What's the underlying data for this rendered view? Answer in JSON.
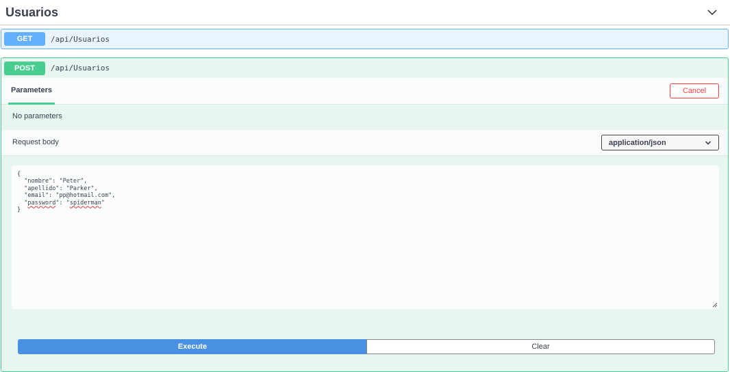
{
  "section": {
    "title": "Usuarios",
    "toggle_icon": "chevron-down-icon"
  },
  "get_op": {
    "method": "GET",
    "path": "/api/Usuarios"
  },
  "post_op": {
    "method": "POST",
    "path": "/api/Usuarios",
    "tab_label": "Parameters",
    "cancel_label": "Cancel",
    "no_params_text": "No parameters",
    "request_body_label": "Request body",
    "content_type": "application/json",
    "body_lines": {
      "open": "{",
      "nombre_key": "\"nombre\"",
      "nombre_val": "\"Peter\",",
      "apellido_key": "\"apellido\"",
      "apellido_val": "\"Parker\",",
      "email_key": "\"email\"",
      "email_val": "\"pp@hotmail.com\",",
      "password_key_q1": "\"",
      "password_key": "password",
      "password_key_q2": "\"",
      "password_val_q1": "\"",
      "password_val": "spiderman",
      "password_val_q2": "\"",
      "close": "}"
    },
    "execute_label": "Execute",
    "clear_label": "Clear"
  },
  "colors": {
    "get": "#61affe",
    "post": "#49cc90",
    "cancel": "#f93e3e",
    "execute": "#4990e2"
  }
}
